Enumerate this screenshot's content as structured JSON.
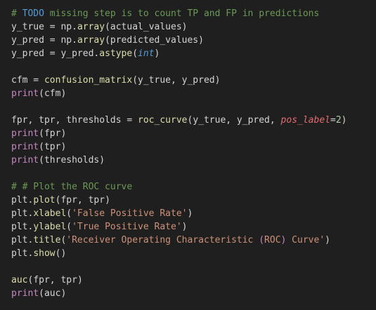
{
  "editor": {
    "lines": [
      [
        {
          "t": "# ",
          "c": "tok-comment"
        },
        {
          "t": "TODO",
          "c": "tok-todo"
        },
        {
          "t": " missing step is to count TP and FP in predictions",
          "c": "tok-comment"
        }
      ],
      [
        {
          "t": "y_true",
          "c": "tok-var"
        },
        {
          "t": " = ",
          "c": "tok-op"
        },
        {
          "t": "np.",
          "c": "tok-var"
        },
        {
          "t": "array",
          "c": "tok-func"
        },
        {
          "t": "(",
          "c": "tok-paren"
        },
        {
          "t": "actual_values",
          "c": "tok-var"
        },
        {
          "t": ")",
          "c": "tok-paren"
        }
      ],
      [
        {
          "t": "y_pred",
          "c": "tok-var"
        },
        {
          "t": " = ",
          "c": "tok-op"
        },
        {
          "t": "np.",
          "c": "tok-var"
        },
        {
          "t": "array",
          "c": "tok-func"
        },
        {
          "t": "(",
          "c": "tok-paren"
        },
        {
          "t": "predicted_values",
          "c": "tok-var"
        },
        {
          "t": ")",
          "c": "tok-paren"
        }
      ],
      [
        {
          "t": "y_pred",
          "c": "tok-var"
        },
        {
          "t": " = ",
          "c": "tok-op"
        },
        {
          "t": "y_pred.",
          "c": "tok-var"
        },
        {
          "t": "astype",
          "c": "tok-func"
        },
        {
          "t": "(",
          "c": "tok-paren"
        },
        {
          "t": "int",
          "c": "tok-type"
        },
        {
          "t": ")",
          "c": "tok-paren"
        }
      ],
      [],
      [
        {
          "t": "cfm",
          "c": "tok-var"
        },
        {
          "t": " = ",
          "c": "tok-op"
        },
        {
          "t": "confusion_matrix",
          "c": "tok-func"
        },
        {
          "t": "(",
          "c": "tok-paren"
        },
        {
          "t": "y_true, y_pred",
          "c": "tok-var"
        },
        {
          "t": ")",
          "c": "tok-paren"
        }
      ],
      [
        {
          "t": "print",
          "c": "tok-builtin"
        },
        {
          "t": "(",
          "c": "tok-paren"
        },
        {
          "t": "cfm",
          "c": "tok-var"
        },
        {
          "t": ")",
          "c": "tok-paren"
        }
      ],
      [],
      [
        {
          "t": "fpr, tpr, thresholds",
          "c": "tok-var"
        },
        {
          "t": " = ",
          "c": "tok-op"
        },
        {
          "t": "roc_curve",
          "c": "tok-func"
        },
        {
          "t": "(",
          "c": "tok-paren"
        },
        {
          "t": "y_true, y_pred, ",
          "c": "tok-var"
        },
        {
          "t": "pos_label",
          "c": "tok-param"
        },
        {
          "t": "=",
          "c": "tok-op"
        },
        {
          "t": "2",
          "c": "tok-num"
        },
        {
          "t": ")",
          "c": "tok-paren"
        }
      ],
      [
        {
          "t": "print",
          "c": "tok-builtin"
        },
        {
          "t": "(",
          "c": "tok-paren"
        },
        {
          "t": "fpr",
          "c": "tok-var"
        },
        {
          "t": ")",
          "c": "tok-paren"
        }
      ],
      [
        {
          "t": "print",
          "c": "tok-builtin"
        },
        {
          "t": "(",
          "c": "tok-paren"
        },
        {
          "t": "tpr",
          "c": "tok-var"
        },
        {
          "t": ")",
          "c": "tok-paren"
        }
      ],
      [
        {
          "t": "print",
          "c": "tok-builtin"
        },
        {
          "t": "(",
          "c": "tok-paren"
        },
        {
          "t": "thresholds",
          "c": "tok-var"
        },
        {
          "t": ")",
          "c": "tok-paren"
        }
      ],
      [],
      [
        {
          "t": "# # Plot the ROC curve",
          "c": "tok-comment"
        }
      ],
      [
        {
          "t": "plt.",
          "c": "tok-var"
        },
        {
          "t": "plot",
          "c": "tok-func"
        },
        {
          "t": "(",
          "c": "tok-paren"
        },
        {
          "t": "fpr, tpr",
          "c": "tok-var"
        },
        {
          "t": ")",
          "c": "tok-paren"
        }
      ],
      [
        {
          "t": "plt.",
          "c": "tok-var"
        },
        {
          "t": "xlabel",
          "c": "tok-func"
        },
        {
          "t": "(",
          "c": "tok-paren"
        },
        {
          "t": "'False Positive Rate'",
          "c": "tok-str"
        },
        {
          "t": ")",
          "c": "tok-paren"
        }
      ],
      [
        {
          "t": "plt.",
          "c": "tok-var"
        },
        {
          "t": "ylabel",
          "c": "tok-func"
        },
        {
          "t": "(",
          "c": "tok-paren"
        },
        {
          "t": "'True Positive Rate'",
          "c": "tok-str"
        },
        {
          "t": ")",
          "c": "tok-paren"
        }
      ],
      [
        {
          "t": "plt.",
          "c": "tok-var"
        },
        {
          "t": "title",
          "c": "tok-func"
        },
        {
          "t": "(",
          "c": "tok-paren"
        },
        {
          "t": "'Receiver Operating Characteristic ",
          "c": "tok-str"
        },
        {
          "t": "(",
          "c": "tok-paren2"
        },
        {
          "t": "ROC",
          "c": "tok-str"
        },
        {
          "t": ")",
          "c": "tok-paren2"
        },
        {
          "t": " Curve'",
          "c": "tok-str"
        },
        {
          "t": ")",
          "c": "tok-paren"
        }
      ],
      [
        {
          "t": "plt.",
          "c": "tok-var"
        },
        {
          "t": "show",
          "c": "tok-func"
        },
        {
          "t": "()",
          "c": "tok-paren"
        }
      ],
      [],
      [
        {
          "t": "auc",
          "c": "tok-func"
        },
        {
          "t": "(",
          "c": "tok-paren"
        },
        {
          "t": "fpr, tpr",
          "c": "tok-var"
        },
        {
          "t": ")",
          "c": "tok-paren"
        }
      ],
      [
        {
          "t": "print",
          "c": "tok-builtin"
        },
        {
          "t": "(",
          "c": "tok-paren"
        },
        {
          "t": "auc",
          "c": "tok-var"
        },
        {
          "t": ")",
          "c": "tok-paren"
        }
      ]
    ]
  },
  "colors": {
    "background": "#1f1f1f",
    "comment": "#6a9955",
    "keyword_todo": "#569cd6",
    "function": "#dcdcaa",
    "builtin": "#c586c0",
    "string": "#ce9178",
    "number": "#b5cea8",
    "param": "#e56b6f",
    "type": "#569cd6",
    "text": "#d4d4d4"
  }
}
